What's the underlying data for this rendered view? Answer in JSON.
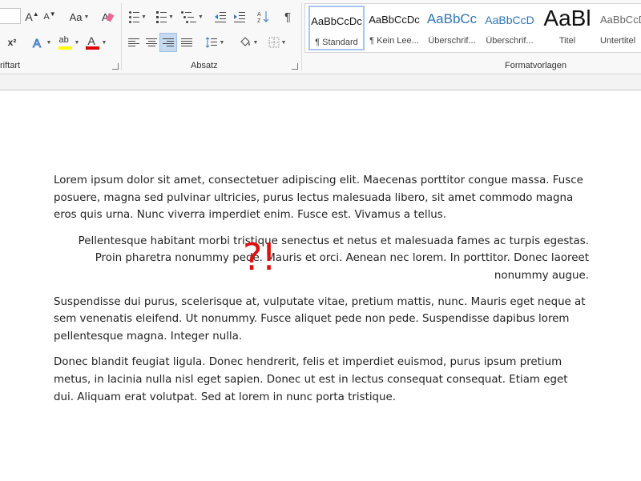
{
  "ribbon": {
    "groups": {
      "font_label": "riftart",
      "paragraph_label": "Absatz",
      "styles_label": "Formatvorlagen"
    },
    "font": {
      "change_case_label": "Aa",
      "grow_label": "A",
      "shrink_label": "A",
      "superscript_label": "x²",
      "highlight_label": "ab",
      "font_color_label": "A",
      "highlight_color": "#ffff00",
      "font_color": "#e00000"
    },
    "paragraph": {
      "show_marks_label": "¶",
      "sort_label": "A↓Z"
    },
    "styles": [
      {
        "sample": "AaBbCcDc",
        "name": "¶ Standard",
        "selected": true
      },
      {
        "sample": "AaBbCcDc",
        "name": "¶ Kein Lee..."
      },
      {
        "sample": "AaBbCc",
        "name": "Überschrif..."
      },
      {
        "sample": "AaBbCcD",
        "name": "Überschrif..."
      },
      {
        "sample": "AaBl",
        "name": "Titel"
      },
      {
        "sample": "AaBbCcD",
        "name": "Untertitel"
      }
    ]
  },
  "document": {
    "paragraphs": [
      "Lorem ipsum dolor sit amet, consectetuer adipiscing elit. Maecenas porttitor congue massa. Fusce posuere, magna sed pulvinar ultricies, purus lectus malesuada libero, sit amet commodo magna eros quis urna. Nunc viverra imperdiet enim. Fusce est. Vivamus a tellus.",
      "Pellentesque habitant morbi tristique senectus et netus et malesuada fames ac turpis egestas. Proin pharetra nonummy pede. Mauris et orci. Aenean nec lorem. In porttitor. Donec laoreet nonummy augue.",
      "Suspendisse dui purus, scelerisque at, vulputate vitae, pretium mattis, nunc. Mauris eget neque at sem venenatis eleifend. Ut nonummy. Fusce aliquet pede non pede. Suspendisse dapibus lorem pellentesque magna. Integer nulla.",
      "Donec blandit feugiat ligula. Donec hendrerit, felis et imperdiet euismod, purus ipsum pretium metus, in lacinia nulla nisl eget sapien. Donec ut est in lectus consequat consequat. Etiam eget dui. Aliquam erat volutpat. Sed at lorem in nunc porta tristique."
    ],
    "overlay_text": "?!",
    "overlay_color": "#e01010"
  }
}
